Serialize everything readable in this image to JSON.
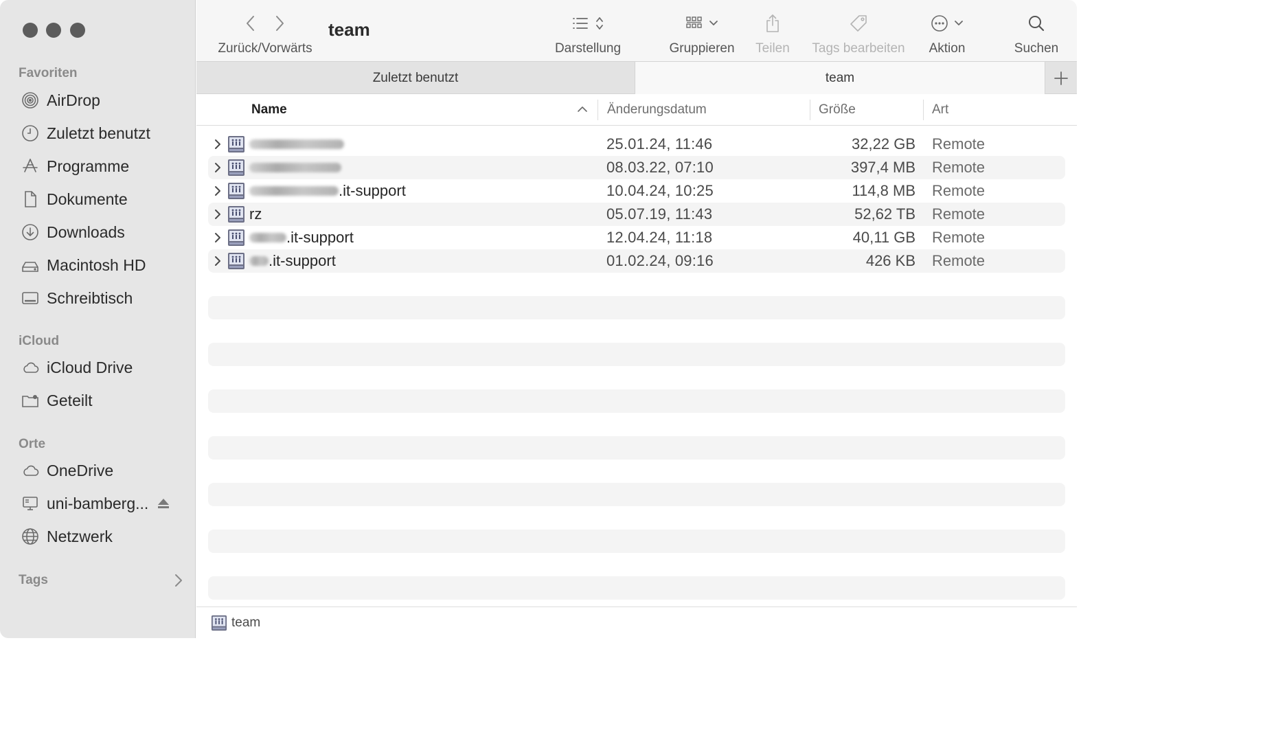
{
  "sidebar": {
    "favorites_title": "Favoriten",
    "favorites": [
      {
        "label": "AirDrop",
        "icon": "airdrop-icon"
      },
      {
        "label": "Zuletzt benutzt",
        "icon": "clock-icon"
      },
      {
        "label": "Programme",
        "icon": "apps-icon"
      },
      {
        "label": "Dokumente",
        "icon": "document-icon"
      },
      {
        "label": "Downloads",
        "icon": "download-icon"
      },
      {
        "label": "Macintosh HD",
        "icon": "harddrive-icon"
      },
      {
        "label": "Schreibtisch",
        "icon": "desktop-icon"
      }
    ],
    "icloud_title": "iCloud",
    "icloud": [
      {
        "label": "iCloud Drive",
        "icon": "cloud-icon"
      },
      {
        "label": "Geteilt",
        "icon": "shared-folder-icon"
      }
    ],
    "places_title": "Orte",
    "places": [
      {
        "label": "OneDrive",
        "icon": "cloud-icon"
      },
      {
        "label": "uni-bamberg...",
        "icon": "server-icon"
      },
      {
        "label": "Netzwerk",
        "icon": "globe-icon"
      }
    ],
    "tags_title": "Tags"
  },
  "toolbar": {
    "nav_label": "Zurück/Vorwärts",
    "title": "team",
    "view_label": "Darstellung",
    "group_label": "Gruppieren",
    "share_label": "Teilen",
    "tags_label": "Tags bearbeiten",
    "action_label": "Aktion",
    "search_label": "Suchen"
  },
  "tabs": [
    {
      "label": "Zuletzt benutzt",
      "active": false
    },
    {
      "label": "team",
      "active": true
    }
  ],
  "columns": {
    "name": "Name",
    "date": "Änderungsdatum",
    "size": "Größe",
    "kind": "Art"
  },
  "rows": [
    {
      "name_suffix": "",
      "date": "25.01.24, 11:46",
      "size": "32,22 GB",
      "kind": "Remote"
    },
    {
      "name_suffix": "",
      "date": "08.03.22, 07:10",
      "size": "397,4 MB",
      "kind": "Remote"
    },
    {
      "name_suffix": ".it-support",
      "date": "10.04.24, 10:25",
      "size": "114,8 MB",
      "kind": "Remote"
    },
    {
      "name_suffix": "rz",
      "date": "05.07.19, 11:43",
      "size": "52,62 TB",
      "kind": "Remote"
    },
    {
      "name_suffix": ".it-support",
      "date": "12.04.24, 11:18",
      "size": "40,11 GB",
      "kind": "Remote"
    },
    {
      "name_suffix": ".it-support",
      "date": "01.02.24, 09:16",
      "size": "426 KB",
      "kind": "Remote"
    }
  ],
  "pathbar": {
    "label": "team"
  }
}
